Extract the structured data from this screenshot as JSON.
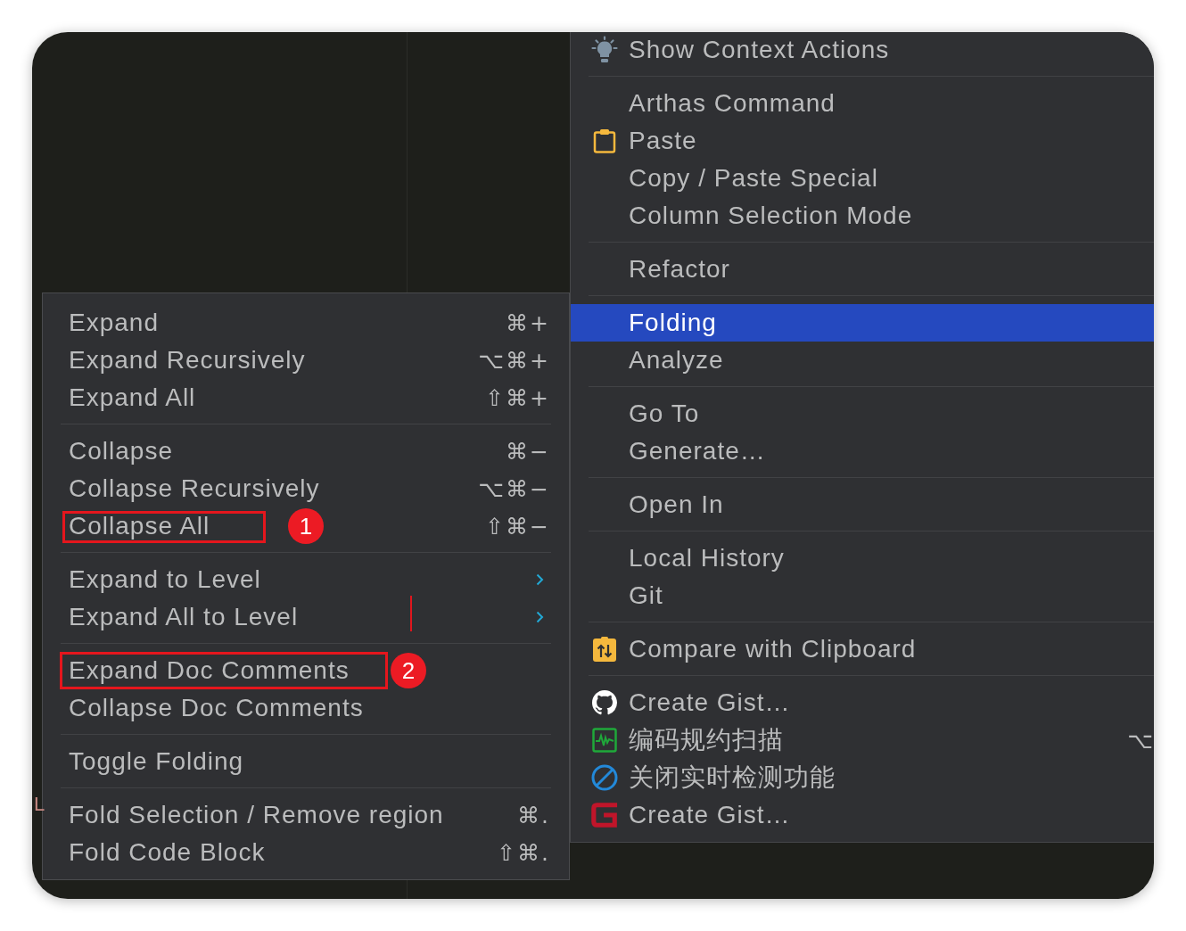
{
  "editor": {
    "text_fragment": "L"
  },
  "context_menu": {
    "groups": [
      {
        "items": [
          {
            "kind": "bulb",
            "label": "Show Context Actions",
            "selected": false
          }
        ]
      },
      {
        "items": [
          {
            "kind": "text",
            "label": "Arthas Command",
            "selected": false
          },
          {
            "kind": "clipboard",
            "label": "Paste",
            "selected": false
          },
          {
            "kind": "text",
            "label": "Copy / Paste Special",
            "selected": false
          },
          {
            "kind": "text",
            "label": "Column Selection Mode",
            "selected": false
          }
        ]
      },
      {
        "items": [
          {
            "kind": "text",
            "label": "Refactor",
            "selected": false
          }
        ]
      },
      {
        "items": [
          {
            "kind": "text",
            "label": "Folding",
            "selected": true
          },
          {
            "kind": "text",
            "label": "Analyze",
            "selected": false
          }
        ]
      },
      {
        "items": [
          {
            "kind": "text",
            "label": "Go To",
            "selected": false
          },
          {
            "kind": "text",
            "label": "Generate…",
            "selected": false
          }
        ]
      },
      {
        "items": [
          {
            "kind": "text",
            "label": "Open In",
            "selected": false
          }
        ]
      },
      {
        "items": [
          {
            "kind": "text",
            "label": "Local History",
            "selected": false
          },
          {
            "kind": "text",
            "label": "Git",
            "selected": false
          }
        ]
      },
      {
        "items": [
          {
            "kind": "compare",
            "label": "Compare with Clipboard",
            "selected": false
          }
        ]
      },
      {
        "items": [
          {
            "kind": "github",
            "label": "Create Gist…",
            "selected": false
          },
          {
            "kind": "scan",
            "label": "编码规约扫描",
            "shortcut": "⌥",
            "selected": false
          },
          {
            "kind": "block",
            "label": "关闭实时检测功能",
            "selected": false
          },
          {
            "kind": "gist",
            "label": "Create Gist…",
            "selected": false
          }
        ]
      }
    ]
  },
  "folding_submenu": {
    "groups": [
      {
        "items": [
          {
            "label": "Expand",
            "shortcut": "⌘+",
            "submenu": false,
            "selected": false
          },
          {
            "label": "Expand Recursively",
            "shortcut": "⌥⌘+",
            "submenu": false,
            "selected": false
          },
          {
            "label": "Expand All",
            "shortcut": "⇧⌘+",
            "submenu": false,
            "selected": false
          }
        ]
      },
      {
        "items": [
          {
            "label": "Collapse",
            "shortcut": "⌘−",
            "submenu": false,
            "selected": false
          },
          {
            "label": "Collapse Recursively",
            "shortcut": "⌥⌘−",
            "submenu": false,
            "selected": false
          },
          {
            "label": "Collapse All",
            "shortcut": "⇧⌘−",
            "submenu": false,
            "selected": false,
            "annotation": "1"
          }
        ]
      },
      {
        "items": [
          {
            "label": "Expand to Level",
            "submenu": true,
            "selected": false
          },
          {
            "label": "Expand All to Level",
            "submenu": true,
            "selected": false
          }
        ]
      },
      {
        "items": [
          {
            "label": "Expand Doc Comments",
            "submenu": false,
            "selected": false,
            "annotation": "2"
          },
          {
            "label": "Collapse Doc Comments",
            "submenu": false,
            "selected": false
          }
        ]
      },
      {
        "items": [
          {
            "label": "Toggle Folding",
            "submenu": false,
            "selected": false
          }
        ]
      },
      {
        "items": [
          {
            "label": "Fold Selection / Remove region",
            "shortcut": "⌘.",
            "submenu": false,
            "selected": false
          },
          {
            "label": "Fold Code Block",
            "shortcut": "⇧⌘.",
            "submenu": false,
            "selected": false
          }
        ]
      }
    ]
  }
}
